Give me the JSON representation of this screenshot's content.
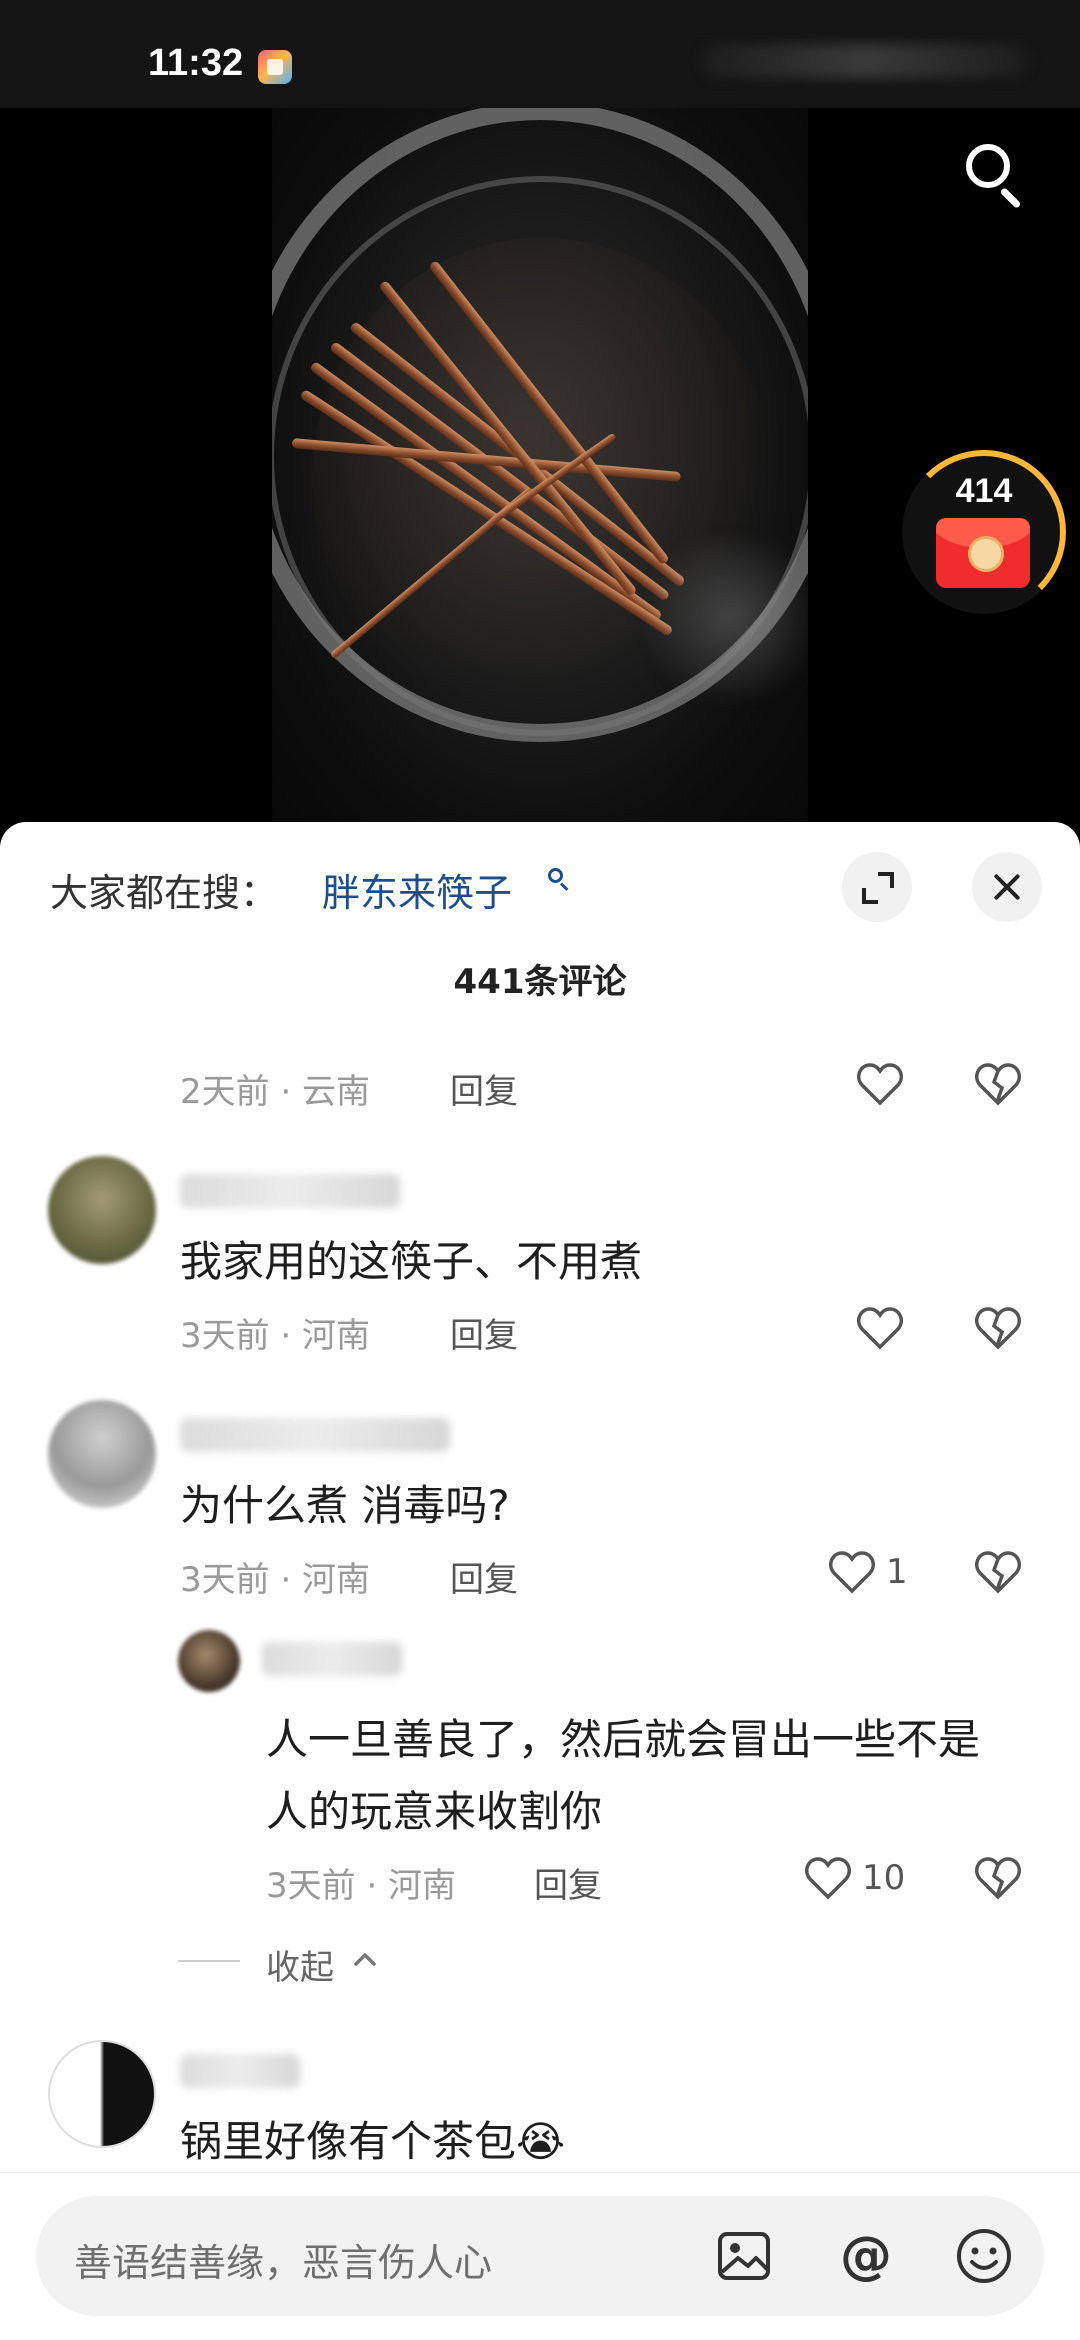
{
  "status_bar": {
    "time": "11:32",
    "app_icon": "app-notification-icon"
  },
  "video": {
    "search_icon": "search-icon"
  },
  "red_packet": {
    "count": "414",
    "icon": "red-envelope-icon"
  },
  "comments_sheet": {
    "trending_label": "大家都在搜：",
    "trending_term": "胖东来筷子",
    "count_title": "441条评论",
    "expand_icon": "expand-icon",
    "close_icon": "close-icon",
    "reply_label": "回复",
    "collapse_label": "收起",
    "comments": [
      {
        "time_location": "2天前 · 云南",
        "like_count": ""
      },
      {
        "text": "我家用的这筷子、不用煮",
        "time_location": "3天前 · 河南",
        "like_count": ""
      },
      {
        "text": "为什么煮 消毒吗?",
        "time_location": "3天前 · 河南",
        "like_count": "1"
      },
      {
        "text": "锅里好像有个茶包😭"
      }
    ],
    "reply": {
      "text_line1": "人一旦善良了，然后就会冒出一些不是",
      "text_line2": "人的玩意来收割你",
      "time_location": "3天前 · 河南",
      "like_count": "10"
    }
  },
  "input_bar": {
    "placeholder": "善语结善缘，恶言伤人心",
    "icons": [
      "image-icon",
      "mention-icon",
      "emoji-icon"
    ],
    "mention_symbol": "@"
  },
  "colors": {
    "trending_link": "#1d4f8c",
    "red_packet": "#f02c2c",
    "ring": "#ffb73a"
  }
}
